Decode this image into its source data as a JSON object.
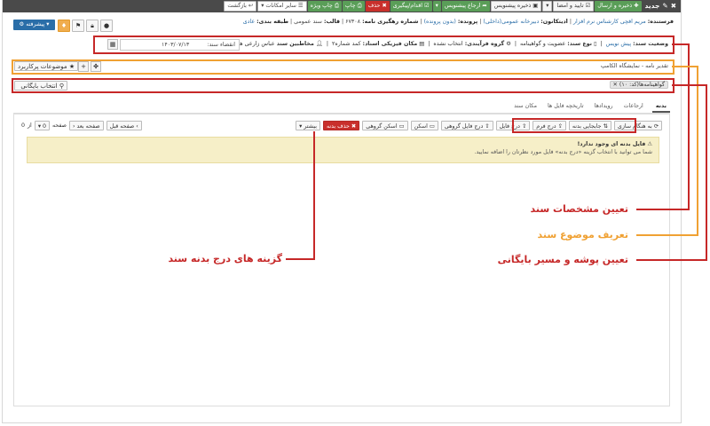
{
  "topbar": {
    "title": "جدید",
    "save_send": "ذخیره و ارسال",
    "approve_sign": "تایید و امضا",
    "save_draft": "ذخیره پیشنویس",
    "refer_draft": "ارجاع پیشنویس",
    "action_followup": "اقدام/پیگیری",
    "delete": "حذف",
    "print": "چاپ",
    "special_print": "چاپ ویژه",
    "other_features": "سایر امکانات",
    "back": "بازگشت"
  },
  "header": {
    "sender_label": "فرستنده:",
    "sender_value": "مریم افچی کارشناس نرم افزار",
    "editor_label": "ادیتکانون:",
    "editor_value": "دبیرخانه عمومی(داخلی)",
    "file_label": "پرونده:",
    "file_value": "(بدون پرونده)",
    "tracking_label": "شماره رهگیری نامه:",
    "tracking_value": "۶۷۳۰۸",
    "template_label": "قالب:",
    "template_value": "سند عمومی",
    "class_label": "طبقه بندی:",
    "class_value": "عادی",
    "advanced": "پیشرفته"
  },
  "doc_row": {
    "status_label": "وضعیت سند:",
    "status_value": "پیش نویس",
    "doctype_label": "نوع سند:",
    "doctype_value": "عضویت و گواهینامه",
    "process_label": "گروه فرآیندی:",
    "process_value": "انتخاب نشده",
    "location_label": "مکان فیزیکی اسناد:",
    "location_value": "کمد شماره۲",
    "recipients_label": "مخاطبین سند",
    "recipients_value": "عباس زارعی هنزک...",
    "expiry_label": "انقضاء سند:",
    "expiry_value": "۱۴۰۳/۰۷/۱۳"
  },
  "subject_row": {
    "subject_value": "تقدیر نامه - نمایشگاه الکامپ",
    "topics_button": "موضوعات پرکاربرد"
  },
  "archive_row": {
    "folder_tag": "گواهینامه‌ها(کد: ۱۰)",
    "archive_button": "انتخاب بایگانی"
  },
  "tabs": [
    "بدنه",
    "ارجاعات",
    "رویدادها",
    "تاریخچه فایل ها",
    "مکان سند"
  ],
  "toolbar": {
    "scan_group": "اسکن گروهی",
    "scan": "اسکن",
    "insert_group_file": "درج فایل گروهی",
    "insert_file": "درج فایل",
    "insert_form": "درج فرم",
    "reorder": "جابجایی بدنه",
    "sync": "به هنگام سازی",
    "delete_body": "حذف بدنه",
    "more": "بیشتر"
  },
  "pager": {
    "prev": "صفحه قبل",
    "next": "صفحه بعد",
    "page_label": "صفحه",
    "page_value": "0",
    "of_label": "از",
    "of_value": "0"
  },
  "alert": {
    "title": "فایل بدنه ای وجود ندارد!",
    "message": "شما می توانید با انتخاب گزینه «درج بدنه» فایل مورد نظرتان را اضافه نمایید."
  },
  "annotations": {
    "doc_specs": "تعیین مشخصات سند",
    "doc_subject": "تعریف موضوع سند",
    "folder_path": "تعیین پوشه و مسیر بایگانی",
    "body_options": "گزینه های درج بدنه سند"
  },
  "colors": {
    "annotation_red": "#c62828",
    "annotation_orange": "#f0a133",
    "primary_green": "#5a9e58",
    "danger_red": "#c9302c",
    "primary_blue": "#2a6ea8",
    "alert_bg": "#f6efc8"
  }
}
